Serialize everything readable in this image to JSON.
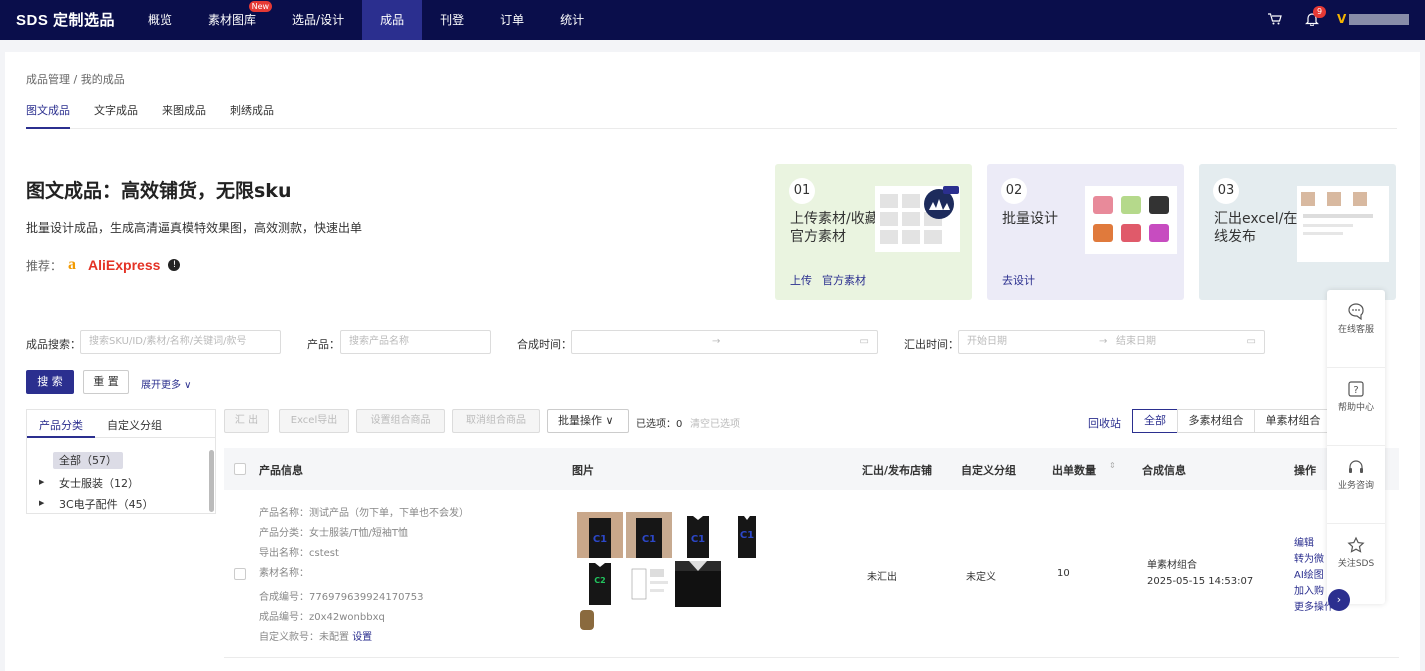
{
  "topbar": {
    "logo": "SDS 定制选品",
    "nav": [
      "概览",
      "素材图库",
      "选品/设计",
      "成品",
      "刊登",
      "订单",
      "统计"
    ],
    "new_badge": "New",
    "bell_count": "9",
    "vip_label": "V"
  },
  "breadcrumb": "成品管理 / 我的成品",
  "tabs": [
    "图文成品",
    "文字成品",
    "来图成品",
    "刺绣成品"
  ],
  "hero": {
    "title": "图文成品：高效铺货，无限sku",
    "desc": "批量设计成品，生成高清逼真模特效果图，高效测款，快速出单",
    "recommend_label": "推荐：",
    "amazon": "a",
    "aliexpress": "AliExpress",
    "info": "!"
  },
  "cards": [
    {
      "num": "01",
      "title": "上传素材/收藏官方素材",
      "link1": "上传",
      "link2": "官方素材",
      "bg": "#eaf4e0"
    },
    {
      "num": "02",
      "title": "批量设计",
      "link1": "去设计",
      "link2": "",
      "bg": "#ecebf7"
    },
    {
      "num": "03",
      "title": "汇出excel/在线发布",
      "link1": "",
      "link2": "",
      "bg": "#e4ecef"
    }
  ],
  "search": {
    "label1": "成品搜索：",
    "ph1": "搜索SKU/ID/素材/名称/关键词/款号",
    "label2": "产品：",
    "ph2": "搜索产品名称",
    "label3": "合成时间：",
    "range_sep": "→",
    "label4": "汇出时间：",
    "ph_start": "开始日期",
    "ph_end": "结束日期"
  },
  "buttons": {
    "search": "搜 索",
    "reset": "重 置",
    "expand": "展开更多 ∨"
  },
  "tree": {
    "tabs": [
      "产品分类",
      "自定义分组"
    ],
    "nodes": [
      "全部（57）",
      "女士服装（12）",
      "3C电子配件（45）"
    ]
  },
  "toolbar": {
    "export": "汇 出",
    "excel": "Excel导出",
    "set_combo": "设置组合商品",
    "cancel_combo": "取消组合商品",
    "bulk": "批量操作",
    "selected": "已选项：0",
    "clear": "清空已选项",
    "recycle": "回收站",
    "seg": [
      "全部",
      "多素材组合",
      "单素材组合"
    ]
  },
  "table": {
    "headers": [
      "产品信息",
      "图片",
      "汇出/发布店铺",
      "自定义分组",
      "出单数量",
      "合成信息",
      "操作"
    ],
    "row": {
      "lines": [
        {
          "k": "产品名称：",
          "v": "测试产品（勿下单，下单也不会发）"
        },
        {
          "k": "产品分类：",
          "v": "女士服装/T恤/短袖T恤"
        },
        {
          "k": "导出名称：",
          "v": "cstest"
        },
        {
          "k": "素材名称：",
          "v": ""
        },
        {
          "k": "合成编号：",
          "v": "776979639924170753"
        },
        {
          "k": "成品编号：",
          "v": "z0x42wonbbxq"
        },
        {
          "k": "自定义款号：",
          "v": "未配置"
        }
      ],
      "set_link": "设置",
      "store": "未汇出",
      "group": "未定义",
      "orders": "10",
      "combo_type": "单素材组合",
      "combo_time": "2025-05-15 14:53:07",
      "ops": [
        "编辑",
        "转为微",
        "AI绘图",
        "加入购",
        "更多操作 ∨"
      ]
    }
  },
  "sidebar": [
    {
      "icon": "chat-icon",
      "label": "在线客服"
    },
    {
      "icon": "help-icon",
      "label": "帮助中心"
    },
    {
      "icon": "headset-icon",
      "label": "业务咨询"
    },
    {
      "icon": "star-icon",
      "label": "关注SDS"
    }
  ]
}
